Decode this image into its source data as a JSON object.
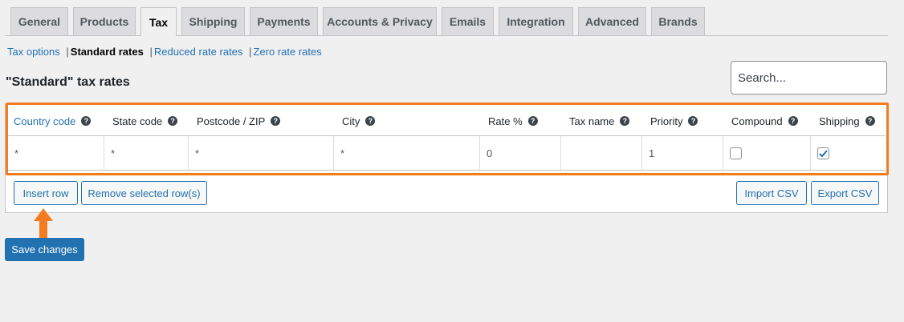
{
  "tabs": [
    {
      "label": "General"
    },
    {
      "label": "Products"
    },
    {
      "label": "Tax"
    },
    {
      "label": "Shipping"
    },
    {
      "label": "Payments"
    },
    {
      "label": "Accounts & Privacy"
    },
    {
      "label": "Emails"
    },
    {
      "label": "Integration"
    },
    {
      "label": "Advanced"
    },
    {
      "label": "Brands"
    }
  ],
  "active_tab": "Tax",
  "subnav": {
    "tax_options": "Tax options",
    "standard_rates": "Standard rates",
    "reduced_rates": "Reduced rate rates",
    "zero_rates": "Zero rate rates",
    "separator": "|"
  },
  "heading": "\"Standard\" tax rates",
  "search": {
    "placeholder": "Search...",
    "value": ""
  },
  "table": {
    "columns": [
      {
        "label": "Country code",
        "help": "?"
      },
      {
        "label": "State code",
        "help": "?"
      },
      {
        "label": "Postcode / ZIP",
        "help": "?"
      },
      {
        "label": "City",
        "help": "?"
      },
      {
        "label": "Rate %",
        "help": "?"
      },
      {
        "label": "Tax name",
        "help": "?"
      },
      {
        "label": "Priority",
        "help": "?"
      },
      {
        "label": "Compound",
        "help": "?"
      },
      {
        "label": "Shipping",
        "help": "?"
      }
    ],
    "row": {
      "country": "*",
      "state": "*",
      "postcode": "*",
      "city": "*",
      "rate": "0",
      "tax_name": "",
      "priority": "1",
      "compound_checked": false,
      "shipping_checked": true
    }
  },
  "buttons": {
    "insert_row": "Insert row",
    "remove_rows": "Remove selected row(s)",
    "import_csv": "Import CSV",
    "export_csv": "Export CSV",
    "save_changes": "Save changes"
  },
  "colors": {
    "highlight": "#f47b20",
    "link": "#2271b1",
    "primary": "#2271b1"
  }
}
